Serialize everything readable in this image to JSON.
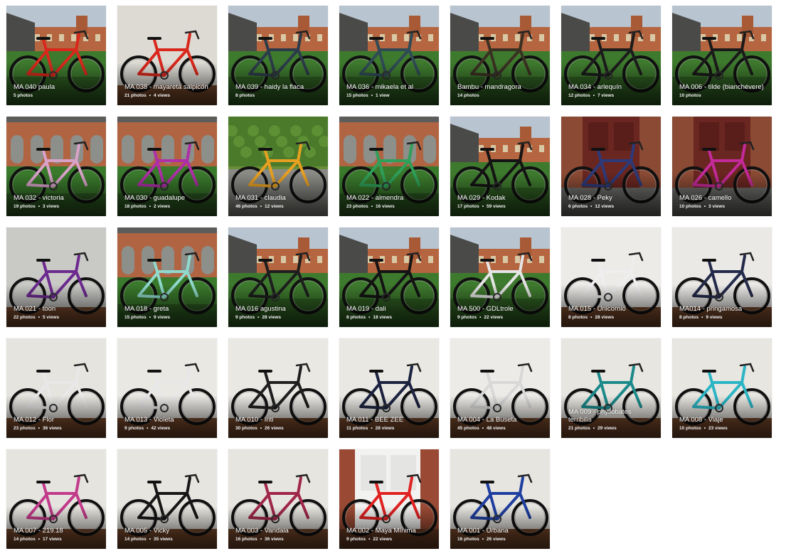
{
  "albums": [
    {
      "title": "MA 040 paula",
      "photos": "5 photos",
      "views": "",
      "scene": "courtyard",
      "bike": "#d9271c",
      "bg": "#ffffff"
    },
    {
      "title": "MA 038 - mayareta salpicón",
      "photos": "21 photos",
      "views": "4 views",
      "scene": "wall",
      "bike": "#d9271c",
      "bg": "#dcdad3"
    },
    {
      "title": "MA 039 - haidy la flaca",
      "photos": "8 photos",
      "views": "",
      "scene": "courtyard",
      "bike": "#2c3b4a",
      "bg": "#ffffff"
    },
    {
      "title": "MA 036 - mikaela et al",
      "photos": "15 photos",
      "views": "1 view",
      "scene": "courtyard",
      "bike": "#2f4a55",
      "bg": "#ffffff"
    },
    {
      "title": "Bambu - mandragora",
      "photos": "14 photos",
      "views": "",
      "scene": "courtyard",
      "bike": "#3a3022",
      "bg": "#ffffff"
    },
    {
      "title": "MA 034 - arlequín",
      "photos": "12 photos",
      "views": "7 views",
      "scene": "courtyard",
      "bike": "#1c1c1c",
      "bg": "#ffffff"
    },
    {
      "title": "MA 006 - tilde (bianchévere)",
      "photos": "10 photos",
      "views": "",
      "scene": "courtyard",
      "bike": "#1a1a1a",
      "bg": "#ffffff"
    },
    {
      "title": "MA 032 - victoria",
      "photos": "19 photos",
      "views": "3 views",
      "scene": "arcade",
      "bike": "#d9a2c9",
      "bg": "#ffffff"
    },
    {
      "title": "MA 030 - guadalupe",
      "photos": "18 photos",
      "views": "2 views",
      "scene": "arcade",
      "bike": "#b02ea8",
      "bg": "#ffffff"
    },
    {
      "title": "MA 031 - claudia",
      "photos": "46 photos",
      "views": "12 views",
      "scene": "hedge",
      "bike": "#e8a021",
      "bg": "#ffffff"
    },
    {
      "title": "MA 022 - almendra",
      "photos": "23 photos",
      "views": "16 views",
      "scene": "arcade",
      "bike": "#2ea05a",
      "bg": "#ffffff"
    },
    {
      "title": "MA 029 - Kodak",
      "photos": "17 photos",
      "views": "59 views",
      "scene": "courtyard",
      "bike": "#141414",
      "bg": "#ffffff"
    },
    {
      "title": "MA 028 - Peky",
      "photos": "6 photos",
      "views": "12 views",
      "scene": "door",
      "bike": "#2c3a7a",
      "bg": "#ffffff"
    },
    {
      "title": "MA 026 - camello",
      "photos": "10 photos",
      "views": "3 views",
      "scene": "door",
      "bike": "#c42a9a",
      "bg": "#ffffff"
    },
    {
      "title": "MA 021 - toon",
      "photos": "22 photos",
      "views": "5 views",
      "scene": "wall",
      "bike": "#6c2a8f",
      "bg": "#c9c9c6"
    },
    {
      "title": "MA 018 - greta",
      "photos": "15 photos",
      "views": "9 views",
      "scene": "arcade",
      "bike": "#8fd9cd",
      "bg": "#ffffff"
    },
    {
      "title": "MA 016 agustina",
      "photos": "9 photos",
      "views": "28 views",
      "scene": "courtyard",
      "bike": "#1e1e1e",
      "bg": "#ffffff"
    },
    {
      "title": "MA 019 - dali",
      "photos": "8 photos",
      "views": "18 views",
      "scene": "courtyard",
      "bike": "#141414",
      "bg": "#ffffff"
    },
    {
      "title": "MA 500 - GDLtrole",
      "photos": "9 photos",
      "views": "22 views",
      "scene": "courtyard",
      "bike": "#e5e5e5",
      "bg": "#ffffff"
    },
    {
      "title": "MA 015 - Unicornio",
      "photos": "8 photos",
      "views": "28 views",
      "scene": "wall",
      "bike": "#eeeeee",
      "bg": "#ecebe8"
    },
    {
      "title": "MA014 - pringamosa",
      "photos": "8 photos",
      "views": "9 views",
      "scene": "wall",
      "bike": "#242a4a",
      "bg": "#eae9e6"
    },
    {
      "title": "MA 012 - Flor",
      "photos": "23 photos",
      "views": "36 views",
      "scene": "wall",
      "bike": "#e8e8e8",
      "bg": "#e6e4df"
    },
    {
      "title": "MA 013 - Violeta",
      "photos": "9 photos",
      "views": "42 views",
      "scene": "wall",
      "bike": "#e7e7e7",
      "bg": "#eae8e3"
    },
    {
      "title": "MA 010 - Inti",
      "photos": "30 photos",
      "views": "26 views",
      "scene": "wall",
      "bike": "#1f1f1f",
      "bg": "#eae8e3"
    },
    {
      "title": "MA 011 - BEE ZEE",
      "photos": "11 photos",
      "views": "28 views",
      "scene": "wall",
      "bike": "#1c2340",
      "bg": "#eae8e3"
    },
    {
      "title": "MA 004 - La Buseta",
      "photos": "45 photos",
      "views": "48 views",
      "scene": "wall",
      "bike": "#d8d8d8",
      "bg": "#ecebe7"
    },
    {
      "title": "MA 009 - phyllobates terribilis",
      "photos": "21 photos",
      "views": "29 views",
      "scene": "wall",
      "bike": "#1c8a8a",
      "bg": "#e8e6e1"
    },
    {
      "title": "MA 008 - Viaje",
      "photos": "10 photos",
      "views": "23 views",
      "scene": "wall",
      "bike": "#2bb5c4",
      "bg": "#e8e6e1"
    },
    {
      "title": "MA 007 - 219.18",
      "photos": "14 photos",
      "views": "17 views",
      "scene": "wall",
      "bike": "#c23a8a",
      "bg": "#e6e4df"
    },
    {
      "title": "MA 005 - Vicky",
      "photos": "14 photos",
      "views": "35 views",
      "scene": "wall",
      "bike": "#161616",
      "bg": "#e7e5e0"
    },
    {
      "title": "MA 003 - Vandala",
      "photos": "16 photos",
      "views": "36 views",
      "scene": "wall",
      "bike": "#a0264a",
      "bg": "#e7e5e0"
    },
    {
      "title": "MA 002 - Maya Mínima",
      "photos": "9 photos",
      "views": "22 views",
      "scene": "brickdoor",
      "bike": "#e02222",
      "bg": "#ffffff"
    },
    {
      "title": "MA 001 - Urbana",
      "photos": "16 photos",
      "views": "26 views",
      "scene": "wall",
      "bike": "#1f3fa0",
      "bg": "#e7e5e0"
    }
  ]
}
